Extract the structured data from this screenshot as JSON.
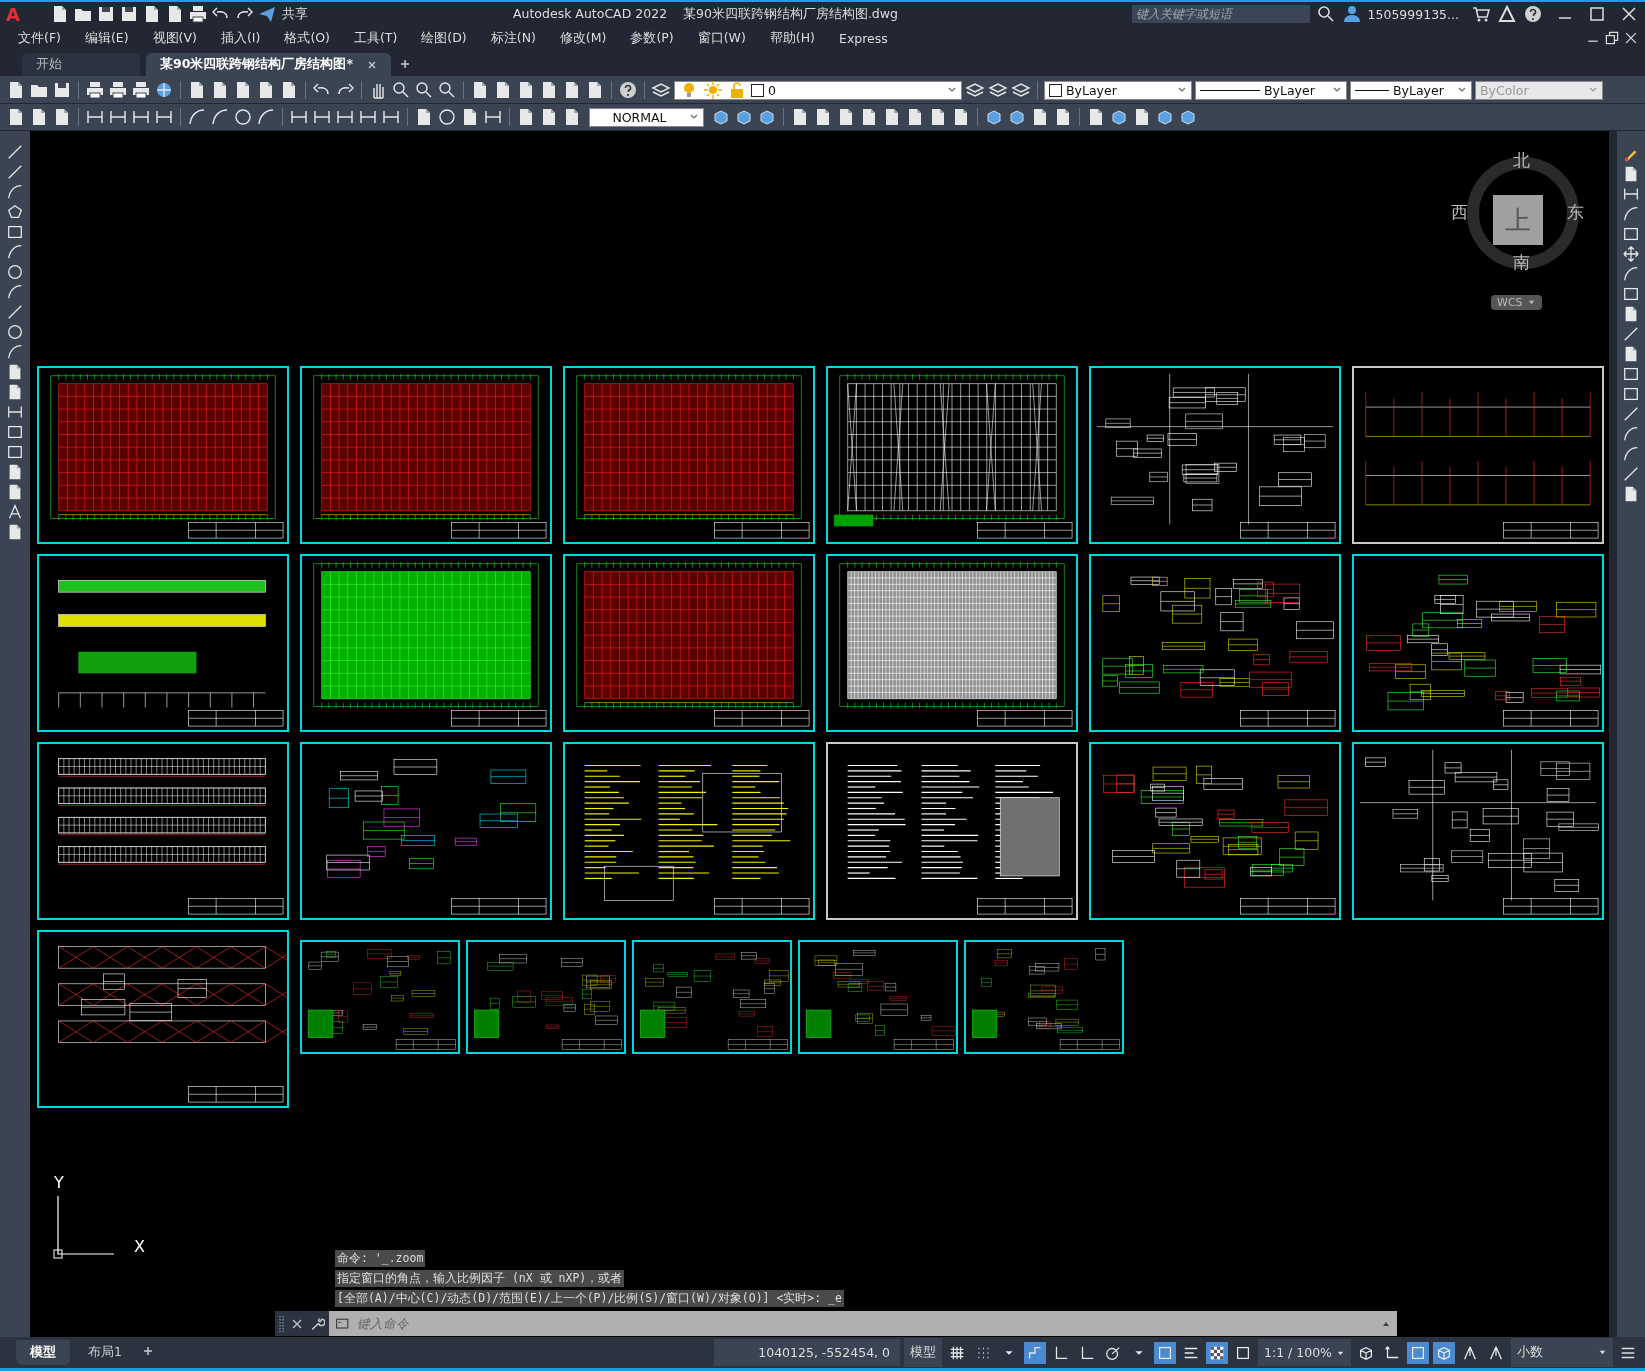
{
  "title_bar": {
    "logo": "A",
    "share_label": "共享",
    "app_title": "Autodesk AutoCAD 2022",
    "file_name": "某90米四联跨钢结构厂房结构图.dwg",
    "search": {
      "placeholder": "键入关键字或短语"
    },
    "user_name": "1505999135..."
  },
  "menu": [
    "文件(F)",
    "编辑(E)",
    "视图(V)",
    "插入(I)",
    "格式(O)",
    "工具(T)",
    "绘图(D)",
    "标注(N)",
    "修改(M)",
    "参数(P)",
    "窗口(W)",
    "帮助(H)",
    "Express"
  ],
  "tabs": [
    {
      "label": "开始",
      "selected": false
    },
    {
      "label": "某90米四联跨钢结构厂房结构图*",
      "selected": true
    }
  ],
  "toolbar": {
    "layer_value": "0",
    "color_value": "ByLayer",
    "linetype_value": "ByLayer",
    "lineweight_value": "ByLayer",
    "plotstyle_value": "ByColor",
    "dimstyle_value": "NORMAL"
  },
  "viewcube": {
    "north": "北",
    "south": "南",
    "east": "东",
    "west": "西",
    "face": "上",
    "coordinate_system": "WCS"
  },
  "ucs_icon": {
    "x_label": "X",
    "y_label": "Y"
  },
  "drawing_sheets": [
    {
      "kind": "plan-red"
    },
    {
      "kind": "plan-red"
    },
    {
      "kind": "plan-red"
    },
    {
      "kind": "plan-bracing"
    },
    {
      "kind": "details-white"
    },
    {
      "kind": "elevation-frames"
    },
    {
      "kind": "elevation-green"
    },
    {
      "kind": "plan-green"
    },
    {
      "kind": "plan-red"
    },
    {
      "kind": "plan-dense"
    },
    {
      "kind": "details-yellow"
    },
    {
      "kind": "details-yellow"
    },
    {
      "kind": "elevation-white"
    },
    {
      "kind": "details-cyan"
    },
    {
      "kind": "notes-yellow"
    },
    {
      "kind": "notes-white"
    },
    {
      "kind": "details-yellow"
    },
    {
      "kind": "details-white"
    },
    {
      "kind": "elevation-bracing"
    },
    {
      "kind": "detail-small"
    },
    {
      "kind": "detail-small"
    },
    {
      "kind": "detail-small"
    },
    {
      "kind": "detail-small"
    },
    {
      "kind": "detail-small"
    }
  ],
  "command_history": [
    "命令: '_.zoom",
    "指定窗口的角点，输入比例因子 (nX 或 nXP)，或者",
    "[全部(A)/中心(C)/动态(D)/范围(E)/上一个(P)/比例(S)/窗口(W)/对象(O)] <实时>: _e"
  ],
  "command_line": {
    "placeholder": "键入命令"
  },
  "layout_tabs": [
    {
      "label": "模型",
      "selected": true
    },
    {
      "label": "布局1",
      "selected": false
    }
  ],
  "status_bar": {
    "coordinates": "1040125, -552454, 0",
    "space": "模型",
    "annotation_scale": "1:1 / 100%",
    "units": "小数",
    "toggles": [
      {
        "on": false
      },
      {
        "on": false
      },
      {
        "on": false
      },
      {
        "on": true
      },
      {
        "on": false
      },
      {
        "on": false
      },
      {
        "on": false
      },
      {
        "on": false
      },
      {
        "on": true
      },
      {
        "on": false
      },
      {
        "on": true
      },
      {
        "on": false
      },
      {
        "on": false
      },
      {
        "on": false
      },
      {
        "on": true
      },
      {
        "on": true
      },
      {
        "on": false
      },
      {
        "on": false
      }
    ]
  }
}
